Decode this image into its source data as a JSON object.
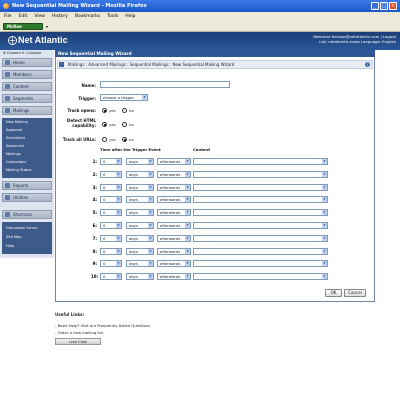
{
  "window": {
    "title": "New Sequential Mailing Wizard - Mozilla Firefox",
    "menu": [
      "File",
      "Edit",
      "View",
      "History",
      "Bookmarks",
      "Tools",
      "Help"
    ],
    "toolbar_button": "McKee"
  },
  "header": {
    "logo": "Net Atlantic",
    "welcome_line": "Welcome tbishop@netatlantic.com | Logout",
    "list_line": "List: netatlantic.news Language: English"
  },
  "sidebar": {
    "expand": "Expand",
    "collapse": "Collapse",
    "items": [
      "Home",
      "Members",
      "Content",
      "Segments",
      "Mailings"
    ],
    "mailings_sub": [
      "New Mailing",
      "Approval",
      "Scheduled",
      "Advanced",
      "Mailings",
      "Campaigns",
      "Mailing Status"
    ],
    "items2": [
      "Reports",
      "Utilities",
      "Shortcuts"
    ],
    "shortcuts_sub": [
      "Discussion Forum",
      "Site Map",
      "Help"
    ]
  },
  "panel": {
    "title": "New Sequential Mailing Wizard",
    "breadcrumb": "Mailings : Advanced Mailings : Sequential Mailings : New Sequential Mailing Wizard",
    "help": "?"
  },
  "form": {
    "name_label": "Name:",
    "trigger_label": "Trigger:",
    "trigger_value": "choose a trigger",
    "track_opens_label": "Track opens:",
    "detect_html_label": "Detect HTML capability:",
    "track_urls_label": "Track all URLs:",
    "yes": "yes",
    "no": "no",
    "col_time": "Time after the Trigger Event",
    "col_content": "Content",
    "rows": [
      {
        "n": "1:",
        "num": "0",
        "unit": "days",
        "when": "afterwards"
      },
      {
        "n": "2:",
        "num": "0",
        "unit": "days",
        "when": "afterwards"
      },
      {
        "n": "3:",
        "num": "0",
        "unit": "days",
        "when": "afterwards"
      },
      {
        "n": "4:",
        "num": "0",
        "unit": "days",
        "when": "afterwards"
      },
      {
        "n": "5:",
        "num": "0",
        "unit": "days",
        "when": "afterwards"
      },
      {
        "n": "6:",
        "num": "0",
        "unit": "days",
        "when": "afterwards"
      },
      {
        "n": "7:",
        "num": "0",
        "unit": "days",
        "when": "afterwards"
      },
      {
        "n": "8:",
        "num": "0",
        "unit": "days",
        "when": "afterwards"
      },
      {
        "n": "9:",
        "num": "0",
        "unit": "days",
        "when": "afterwards"
      },
      {
        "n": "10:",
        "num": "0",
        "unit": "days",
        "when": "afterwards"
      }
    ],
    "ok": "OK",
    "cancel": "Cancel"
  },
  "footer": {
    "useful": "Useful Links:",
    "link1": "- Need Help? Visit our Frequently Asked Questions",
    "link2": "- Order a new mailing list",
    "live_chat": "Live Chat"
  }
}
